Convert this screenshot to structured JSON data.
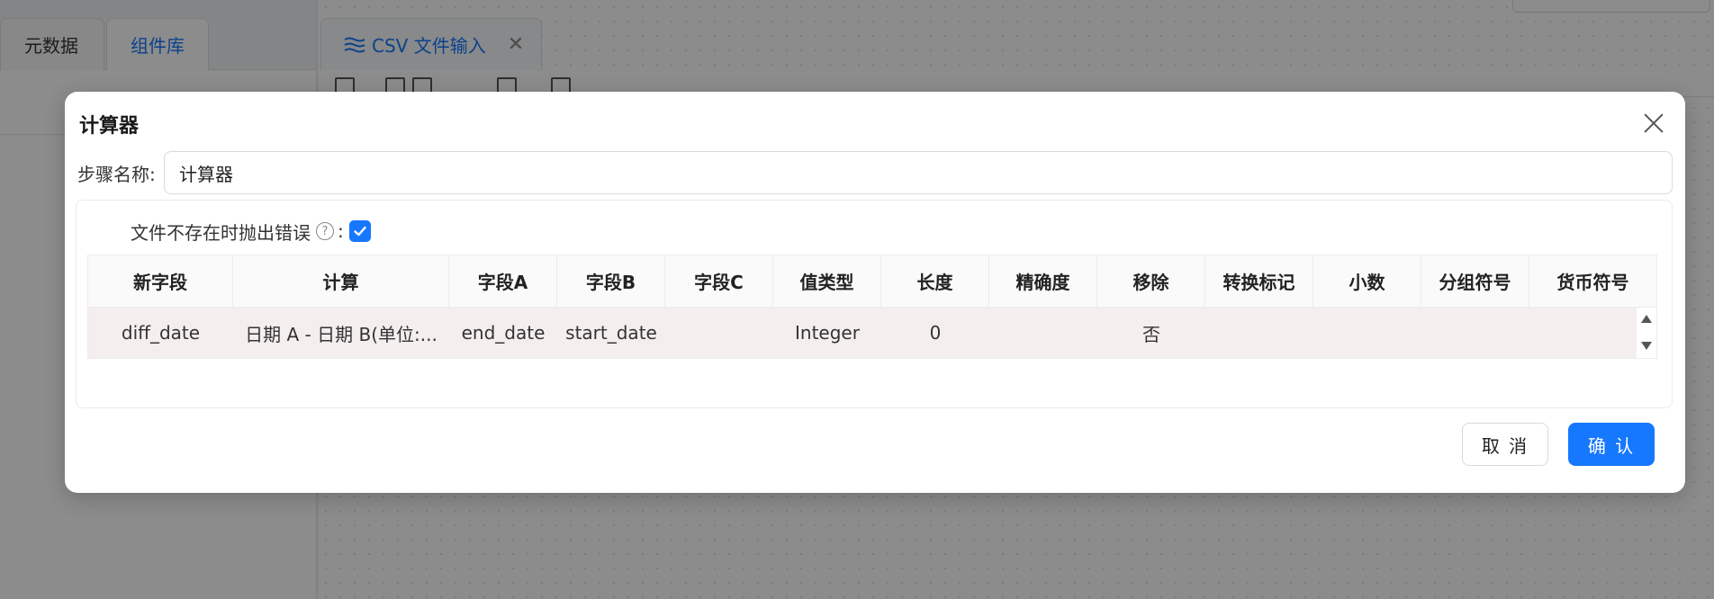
{
  "background": {
    "left_tabs": [
      "元数据",
      "组件库"
    ],
    "editor_tab": {
      "label": "CSV 文件输入"
    }
  },
  "dialog": {
    "title": "计算器",
    "step_name_label": "步骤名称:",
    "step_name_value": "计算器",
    "option": {
      "label": "文件不存在时抛出错误",
      "colon": ":",
      "help_glyph": "?",
      "checked": true
    },
    "table": {
      "columns": [
        "新字段",
        "计算",
        "字段A",
        "字段B",
        "字段C",
        "值类型",
        "长度",
        "精确度",
        "移除",
        "转换标记",
        "小数",
        "分组符号",
        "货币符号"
      ],
      "rows": [
        [
          "diff_date",
          "日期 A - 日期 B(单位:...",
          "end_date",
          "start_date",
          "",
          "Integer",
          "0",
          "",
          "否",
          "",
          "",
          "",
          ""
        ]
      ]
    },
    "buttons": {
      "cancel": "取 消",
      "ok": "确 认"
    }
  },
  "colors": {
    "primary": "#1677ff",
    "row_bg": "#f4eeee",
    "mask": "rgba(0,0,0,0.45)"
  }
}
